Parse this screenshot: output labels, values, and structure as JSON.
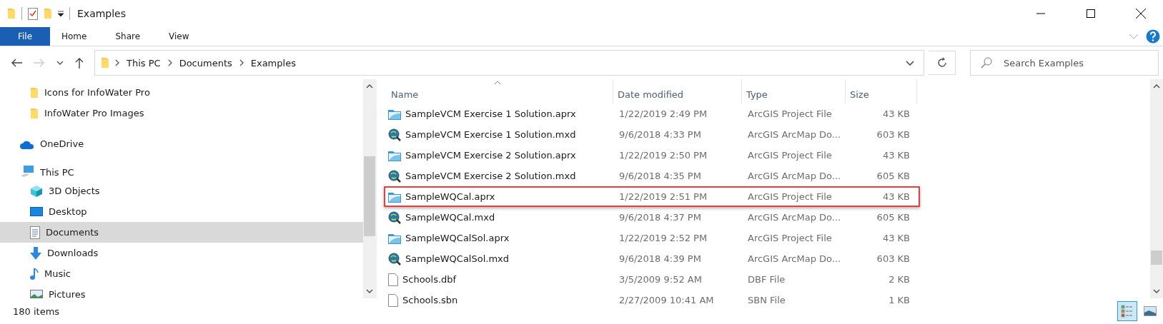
{
  "window": {
    "title": "Examples"
  },
  "ribbon_tabs": [
    {
      "label": "File",
      "selected": true
    },
    {
      "label": "Home",
      "selected": false
    },
    {
      "label": "Share",
      "selected": false
    },
    {
      "label": "View",
      "selected": false
    }
  ],
  "address_bar": {
    "path": [
      "This PC",
      "Documents",
      "Examples"
    ]
  },
  "search": {
    "placeholder": "Search Examples"
  },
  "sidebar": {
    "items": [
      {
        "label": "Icons for InfoWater Pro",
        "kind": "folder",
        "selected": false
      },
      {
        "label": "InfoWater Pro Images",
        "kind": "folder",
        "selected": false
      },
      {
        "label": "OneDrive",
        "kind": "cloud",
        "selected": false
      },
      {
        "label": "This PC",
        "kind": "pc",
        "selected": false,
        "children": [
          {
            "label": "3D Objects",
            "kind": "cube",
            "selected": false
          },
          {
            "label": "Desktop",
            "kind": "desktop",
            "selected": false
          },
          {
            "label": "Documents",
            "kind": "documents",
            "selected": true
          },
          {
            "label": "Downloads",
            "kind": "download",
            "selected": false
          },
          {
            "label": "Music",
            "kind": "music",
            "selected": false
          },
          {
            "label": "Pictures",
            "kind": "pictures",
            "selected": false
          }
        ]
      }
    ]
  },
  "table": {
    "columns": [
      "Name",
      "Date modified",
      "Type",
      "Size"
    ],
    "rows": [
      {
        "kind": "aprx",
        "name": "SampleVCM Exercise 1 Solution.aprx",
        "date": "1/22/2019 2:49 PM",
        "type": "ArcGIS Project File",
        "size": "43 KB",
        "highlighted": false
      },
      {
        "kind": "mxd",
        "name": "SampleVCM Exercise 1 Solution.mxd",
        "date": "9/6/2018 4:33 PM",
        "type": "ArcGIS ArcMap Do...",
        "size": "603 KB",
        "highlighted": false
      },
      {
        "kind": "aprx",
        "name": "SampleVCM Exercise 2 Solution.aprx",
        "date": "1/22/2019 2:50 PM",
        "type": "ArcGIS Project File",
        "size": "43 KB",
        "highlighted": false
      },
      {
        "kind": "mxd",
        "name": "SampleVCM Exercise 2 Solution.mxd",
        "date": "9/6/2018 4:35 PM",
        "type": "ArcGIS ArcMap Do...",
        "size": "605 KB",
        "highlighted": false
      },
      {
        "kind": "aprx",
        "name": "SampleWQCal.aprx",
        "date": "1/22/2019 2:51 PM",
        "type": "ArcGIS Project File",
        "size": "43 KB",
        "highlighted": true
      },
      {
        "kind": "mxd",
        "name": "SampleWQCal.mxd",
        "date": "9/6/2018 4:37 PM",
        "type": "ArcGIS ArcMap Do...",
        "size": "605 KB",
        "highlighted": false
      },
      {
        "kind": "aprx",
        "name": "SampleWQCalSol.aprx",
        "date": "1/22/2019 2:52 PM",
        "type": "ArcGIS Project File",
        "size": "43 KB",
        "highlighted": false
      },
      {
        "kind": "mxd",
        "name": "SampleWQCalSol.mxd",
        "date": "9/6/2018 4:39 PM",
        "type": "ArcGIS ArcMap Do...",
        "size": "603 KB",
        "highlighted": false
      },
      {
        "kind": "file",
        "name": "Schools.dbf",
        "date": "3/5/2009 9:52 AM",
        "type": "DBF File",
        "size": "2 KB",
        "highlighted": false
      },
      {
        "kind": "file",
        "name": "Schools.sbn",
        "date": "2/27/2009 10:41 AM",
        "type": "SBN File",
        "size": "1 KB",
        "highlighted": false
      }
    ]
  },
  "status_bar": {
    "count": "180 items",
    "views": [
      {
        "kind": "details",
        "selected": true
      },
      {
        "kind": "thumbnails",
        "selected": false
      }
    ]
  }
}
